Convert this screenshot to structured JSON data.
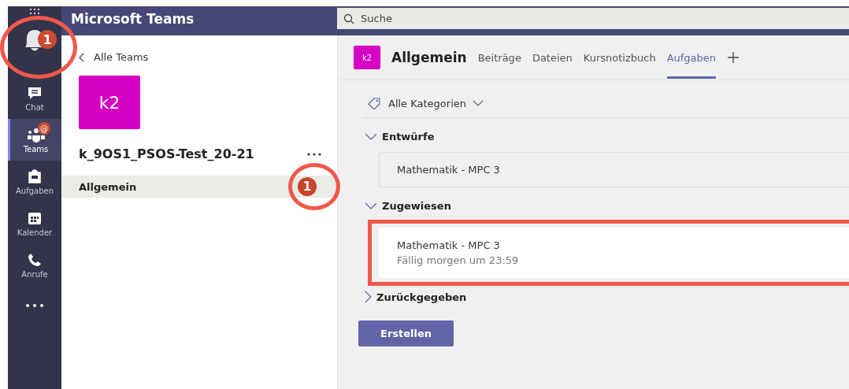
{
  "app_bar": {
    "title": "Microsoft Teams",
    "search": {
      "placeholder": "Suche"
    }
  },
  "rail": [
    {
      "kind": "bell",
      "selected": false,
      "badge": "1",
      "circled": true
    },
    {
      "kind": "chat",
      "label": "Chat",
      "selected": false
    },
    {
      "kind": "teams",
      "label": "Teams",
      "selected": true,
      "badge": "@"
    },
    {
      "kind": "assignments",
      "label": "Aufgaben",
      "selected": false
    },
    {
      "kind": "calendar",
      "label": "Kalender",
      "selected": false
    },
    {
      "kind": "calls",
      "label": "Anrufe",
      "selected": false
    },
    {
      "kind": "more",
      "selected": false
    }
  ],
  "team_panel": {
    "back_link": "Alle Teams",
    "avatar": "k2",
    "team_name": "k_9OS1_PSOS-Test_20-21",
    "channels": [
      {
        "name": "Allgemein",
        "selected": true,
        "badge": "1",
        "circled": true
      }
    ]
  },
  "channel_header": {
    "avatar": "k2",
    "title": "Allgemein",
    "tabs": [
      {
        "label": "Beiträge",
        "selected": false
      },
      {
        "label": "Dateien",
        "selected": false
      },
      {
        "label": "Kursnotizbuch",
        "selected": false
      },
      {
        "label": "Aufgaben",
        "selected": true
      }
    ]
  },
  "filter": {
    "label": "Alle Kategorien"
  },
  "sections": [
    {
      "title": "Entwürfe",
      "expanded": true,
      "items": [
        {
          "title": "Mathematik - MPC 3"
        }
      ]
    },
    {
      "title": "Zugewiesen",
      "expanded": true,
      "framed": true,
      "items": [
        {
          "title": "Mathematik - MPC 3",
          "due": "Fällig morgen um 23:59"
        }
      ]
    },
    {
      "title": "Zurückgegeben",
      "expanded": false
    }
  ],
  "create_button": "Erstellen"
}
